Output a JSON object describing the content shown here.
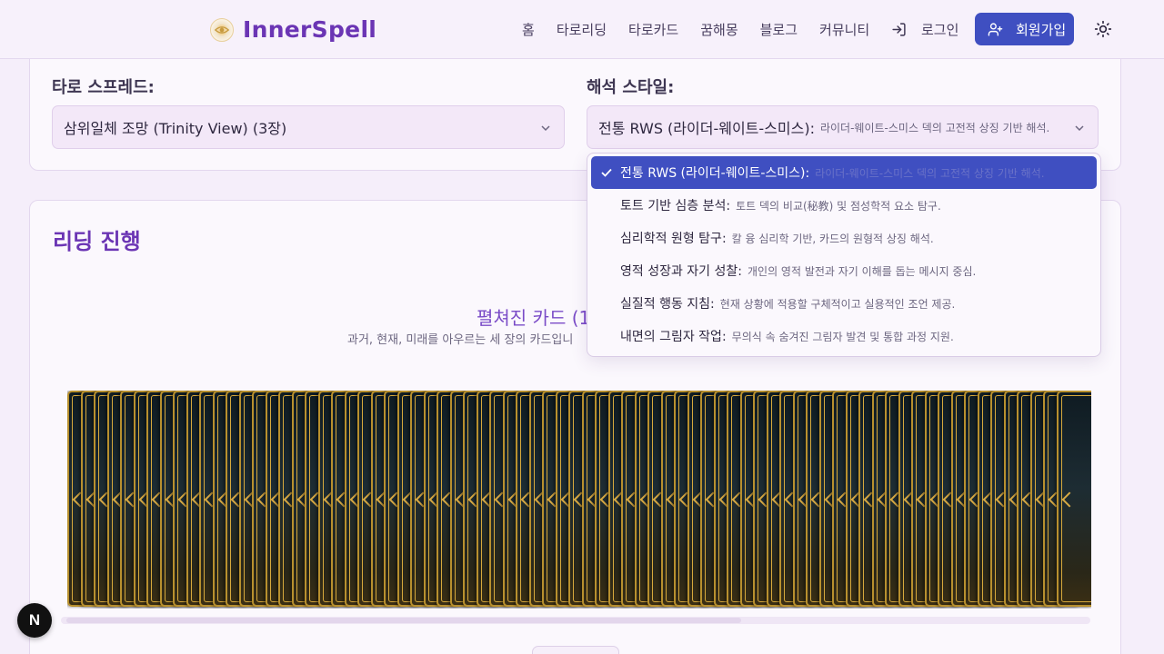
{
  "header": {
    "brand": "InnerSpell",
    "nav": [
      "홈",
      "타로리딩",
      "타로카드",
      "꿈해몽",
      "블로그",
      "커뮤니티"
    ],
    "login_label": "로그인",
    "signup_label": "회원가입",
    "accent_color": "#3f4fc1",
    "brand_color": "#6b35b4"
  },
  "settings": {
    "spread_label": "타로 스프레드:",
    "spread_value": "삼위일체 조망 (Trinity View) (3장)",
    "style_label": "해석 스타일:",
    "style_value": "전통 RWS (라이더-웨이트-스미스):",
    "style_value_desc": "라이더-웨이트-스미스 덱의 고전적 상징 기반 해석."
  },
  "style_options": [
    {
      "label": "전통 RWS (라이더-웨이트-스미스):",
      "desc": "라이더-웨이트-스미스 덱의 고전적 상징 기반 해석.",
      "selected": true
    },
    {
      "label": "토트 기반 심층 분석:",
      "desc": "토트 덱의 비교(秘教) 및 점성학적 요소 탐구.",
      "selected": false
    },
    {
      "label": "심리학적 원형 탐구:",
      "desc": "칼 융 심리학 기반, 카드의 원형적 상징 해석.",
      "selected": false
    },
    {
      "label": "영적 성장과 자기 성찰:",
      "desc": "개인의 영적 발전과 자기 이해를 돕는 메시지 중심.",
      "selected": false
    },
    {
      "label": "실질적 행동 지침:",
      "desc": "현재 상황에 적용할 구체적이고 실용적인 조언 제공.",
      "selected": false
    },
    {
      "label": "내면의 그림자 작업:",
      "desc": "무의식 속 숨겨진 그림자 발견 및 통합 과정 지원.",
      "selected": false
    }
  ],
  "reading": {
    "title": "리딩 진행",
    "spread_title": "펼쳐진 카드 (1",
    "spread_sub": "과거, 현재, 미래를 아우르는 세 장의 카드입니"
  },
  "next_badge": "N"
}
